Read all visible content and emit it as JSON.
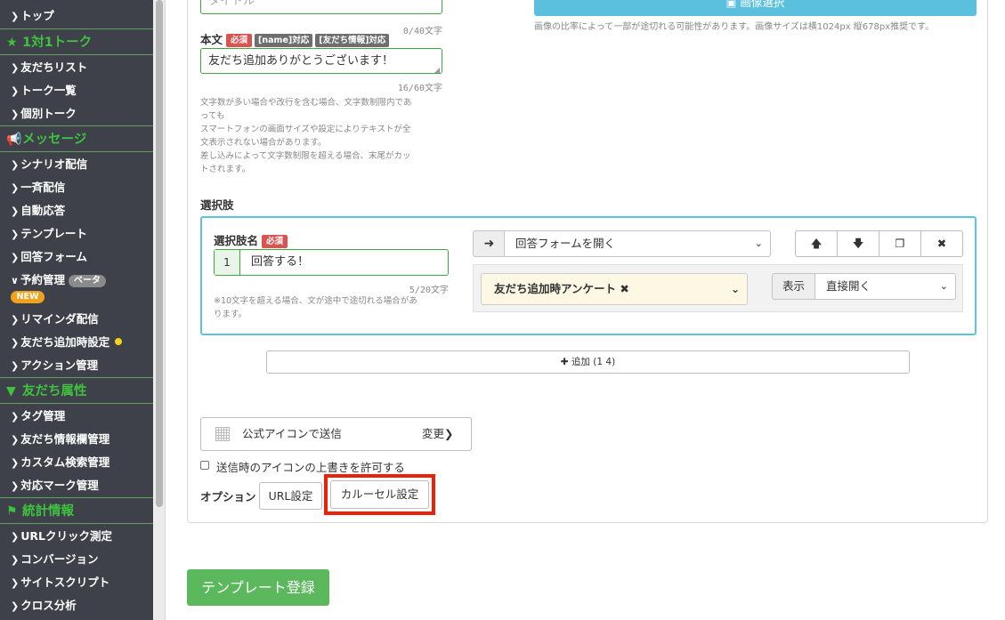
{
  "sidebar": {
    "top_item": "トップ",
    "sections": [
      {
        "title": "1対1トーク",
        "icon": "star-icon",
        "items": [
          "友だちリスト",
          "トーク一覧",
          "個別トーク"
        ]
      },
      {
        "title": "メッセージ",
        "icon": "megaphone-icon",
        "items": [
          "シナリオ配信",
          "一斉配信",
          "自動応答",
          "テンプレート",
          "回答フォーム",
          "予約管理",
          "リマインダ配信",
          "友だち追加時設定",
          "アクション管理"
        ]
      },
      {
        "title": "友だち属性",
        "icon": "filter-icon",
        "items": [
          "タグ管理",
          "友だち情報欄管理",
          "カスタム検索管理",
          "対応マーク管理"
        ]
      },
      {
        "title": "統計情報",
        "icon": "flag-icon",
        "items": [
          "URLクリック測定",
          "コンバージョン",
          "サイトスクリプト",
          "クロス分析"
        ]
      }
    ],
    "beta_label": "ベータ",
    "new_label": "NEW"
  },
  "form": {
    "title_placeholder": "タイトル",
    "title_counter": "0/40文字",
    "image_button_label": "画像選択",
    "image_note": "画像の比率によって一部が途切れる可能性があります。画像サイズは横1024px 縦678px推奨です。",
    "body_label": "本文",
    "required_label": "必須",
    "name_tag": "[name]対応",
    "friend_info_tag": "[友だち情報]対応",
    "body_value": "友だち追加ありがとうございます！",
    "body_counter": "16/60文字",
    "body_note_lines": [
      "文字数が多い場合や改行を含む場合、文字数制限内であ",
      "っても",
      "スマートフォンの画面サイズや設定によりテキストが全",
      "文表示されない場合があります。",
      "差し込みによって文字数制限を超える場合、末尾がカッ",
      "トされます。"
    ],
    "choices_label": "選択肢"
  },
  "choice": {
    "name_label": "選択肢名",
    "required_label": "必須",
    "index": "1",
    "value": "回答する！",
    "counter": "5/20文字",
    "note_lines": [
      "※10文字を超える場合、文が途中で途切れる場合があ",
      "ります。"
    ],
    "action_select": "回答フォームを開く",
    "form_select": "友だち追加時アンケート",
    "display_label": "表示",
    "display_select": "直接開く"
  },
  "add_button_label": "追加 (1 4)",
  "sender": {
    "label": "公式アイコンで送信",
    "change_label": "変更"
  },
  "allow_icon_override_label": "送信時のアイコンの上書きを許可する",
  "options": {
    "label": "オプション",
    "url_button": "URL設定",
    "carousel_button": "カルーセル設定"
  },
  "register_button": "テンプレート登録",
  "colors": {
    "sidebar_bg": "#3e4149",
    "sidebar_section": "#3ec33e",
    "accent_blue": "#5bc0de",
    "green_button": "#5cb85c",
    "required_red": "#d9534f",
    "highlight_red": "#e8230a",
    "choice_box_border": "#5ec3dc"
  }
}
